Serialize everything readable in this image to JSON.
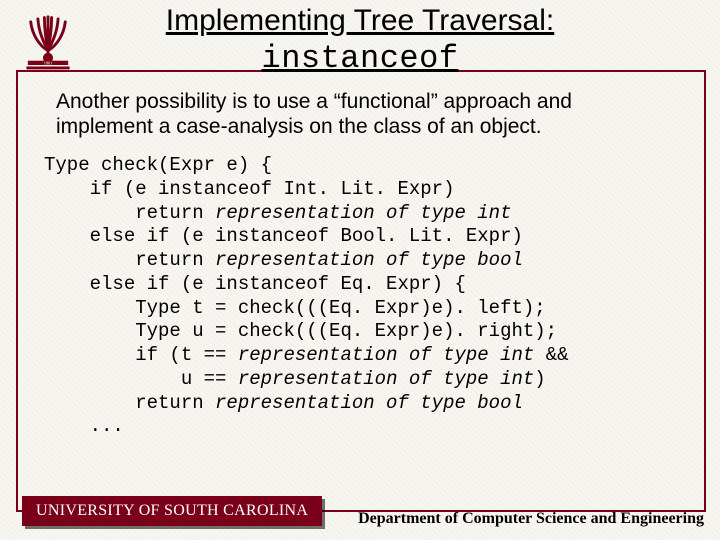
{
  "title": {
    "line1": "Implementing Tree Traversal:",
    "line2": "instanceof"
  },
  "intro": "Another possibility is to use a “functional” approach and implement a case-analysis on the class of an object.",
  "code": {
    "l1": "Type check(Expr e) {",
    "l2": "    if (e instanceof Int. Lit. Expr)",
    "l3a": "        return ",
    "l3b": "representation of type int",
    "l4": "    else if (e instanceof Bool. Lit. Expr)",
    "l5a": "        return ",
    "l5b": "representation of type bool",
    "l6": "    else if (e instanceof Eq. Expr) {",
    "l7": "        Type t = check(((Eq. Expr)e). left);",
    "l8": "        Type u = check(((Eq. Expr)e). right);",
    "l9a": "        if (t == ",
    "l9b": "representation of type int",
    "l9c": " &&",
    "l10a": "            u == ",
    "l10b": "representation of type int",
    "l10c": ")",
    "l11a": "        return ",
    "l11b": "representation of type bool",
    "l12": "    ..."
  },
  "footer": {
    "left": "UNIVERSITY OF SOUTH CAROLINA",
    "right": "Department of Computer Science and Engineering"
  }
}
